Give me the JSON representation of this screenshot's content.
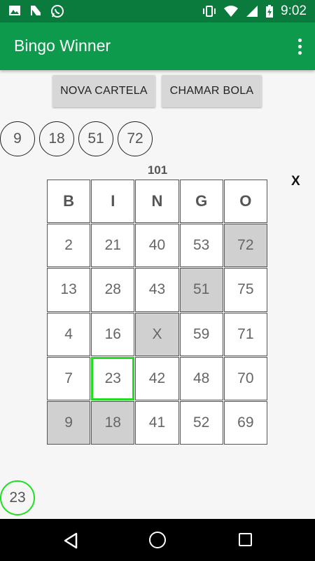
{
  "status_bar": {
    "time": "9:02",
    "left_icons": [
      "image-icon",
      "n-icon",
      "whatsapp-icon"
    ],
    "right_icons": [
      "vibrate-icon",
      "wifi-icon",
      "signal-icon",
      "battery-charging-icon"
    ]
  },
  "app_bar": {
    "title": "Bingo Winner",
    "menu_icon": "overflow-menu-icon"
  },
  "buttons": {
    "new_card": "NOVA CARTELA",
    "call_ball": "CHAMAR BOLA"
  },
  "called_balls": [
    "9",
    "18",
    "51",
    "72"
  ],
  "card": {
    "number": "101",
    "close_label": "X",
    "headers": [
      "B",
      "I",
      "N",
      "G",
      "O"
    ],
    "rows": [
      [
        {
          "v": "2",
          "m": false
        },
        {
          "v": "21",
          "m": false
        },
        {
          "v": "40",
          "m": false
        },
        {
          "v": "53",
          "m": false
        },
        {
          "v": "72",
          "m": true
        }
      ],
      [
        {
          "v": "13",
          "m": false
        },
        {
          "v": "28",
          "m": false
        },
        {
          "v": "43",
          "m": false
        },
        {
          "v": "51",
          "m": true
        },
        {
          "v": "75",
          "m": false
        }
      ],
      [
        {
          "v": "4",
          "m": false
        },
        {
          "v": "16",
          "m": false
        },
        {
          "v": "X",
          "m": true
        },
        {
          "v": "59",
          "m": false
        },
        {
          "v": "71",
          "m": false
        }
      ],
      [
        {
          "v": "7",
          "m": false
        },
        {
          "v": "23",
          "m": false,
          "last": true
        },
        {
          "v": "42",
          "m": false
        },
        {
          "v": "48",
          "m": false
        },
        {
          "v": "70",
          "m": false
        }
      ],
      [
        {
          "v": "9",
          "m": true
        },
        {
          "v": "18",
          "m": true
        },
        {
          "v": "41",
          "m": false
        },
        {
          "v": "52",
          "m": false
        },
        {
          "v": "69",
          "m": false
        }
      ]
    ]
  },
  "last_ball": "23",
  "colors": {
    "status_bar": "#0a7a3d",
    "app_bar": "#0e9a4c",
    "marked_cell": "#d0d0d0",
    "highlight": "#22dd22"
  },
  "nav_bar": {
    "icons": [
      "back-icon",
      "home-icon",
      "recent-apps-icon"
    ]
  }
}
